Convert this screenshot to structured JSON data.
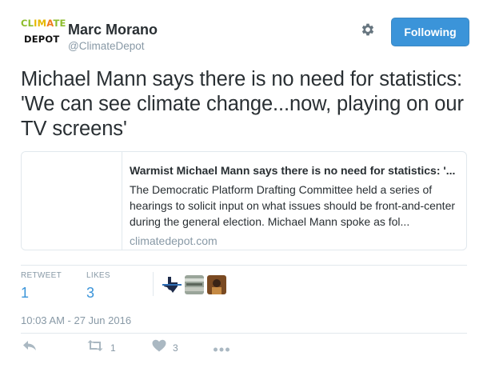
{
  "author": {
    "avatar_line1": "CLIMATE",
    "avatar_line2": "DEPOT",
    "name": "Marc Morano",
    "handle": "@ClimateDepot"
  },
  "header": {
    "settings_icon": "gear-icon",
    "follow_label": "Following"
  },
  "tweet": {
    "text": "Michael Mann says there is no need for statistics: 'We can see climate change...now, playing on our TV screens'"
  },
  "card": {
    "title": "Warmist Michael Mann says there is no need for statistics: '...",
    "description": "The Democratic Platform Drafting Committee held a series of hearings to solicit input on what issues should be front-and-center during the general election. Michael Mann spoke as fol...",
    "domain": "climatedepot.com"
  },
  "stats": {
    "retweets_label": "RETWEET",
    "retweets_count": "1",
    "likes_label": "LIKES",
    "likes_count": "3"
  },
  "timestamp": "10:03 AM - 27 Jun 2016",
  "actions": {
    "reply_icon": "reply-icon",
    "retweet_icon": "retweet-icon",
    "retweet_count": "1",
    "like_icon": "heart-icon",
    "like_count": "3",
    "more_icon": "more-dots-icon"
  },
  "colors": {
    "accent": "#3b94d9",
    "muted": "#8899a6",
    "text": "#292f33",
    "border": "#e1e8ed"
  }
}
